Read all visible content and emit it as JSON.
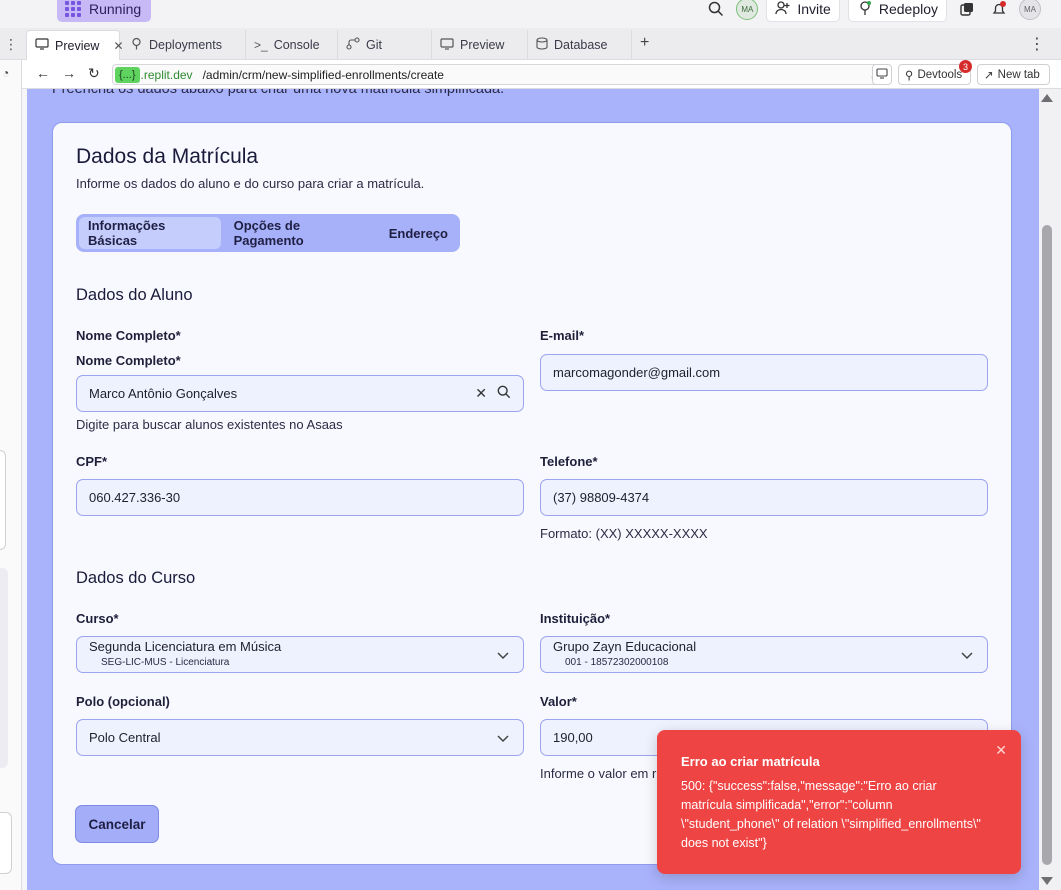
{
  "topbar": {
    "status": "Running",
    "invite": "Invite",
    "redeploy": "Redeploy",
    "avatar1": "MA",
    "avatar2": "MA"
  },
  "tabs": [
    {
      "label": "Preview",
      "icon": "monitor-icon"
    },
    {
      "label": "Deployments",
      "icon": "deploy-icon"
    },
    {
      "label": "Console",
      "icon": "terminal-icon"
    },
    {
      "label": "Git",
      "icon": "git-icon"
    },
    {
      "label": "Preview",
      "icon": "monitor-icon"
    },
    {
      "label": "Database",
      "icon": "database-icon"
    }
  ],
  "urlbar": {
    "host_badge": "{...}",
    "host": ".replit.dev",
    "path": "/admin/crm/new-simplified-enrollments/create",
    "devtools": "Devtools",
    "devtools_count": "3",
    "new_tab": "New tab"
  },
  "page": {
    "cut_text": "Preencha os dados abaixo para criar uma nova matrícula simplificada.",
    "title": "Dados da Matrícula",
    "subtitle": "Informe os dados do aluno e do curso para criar a matrícula.",
    "tabs": [
      "Informações Básicas",
      "Opções de Pagamento",
      "Endereço"
    ],
    "student_section": "Dados do Aluno",
    "name_label": "Nome Completo*",
    "name_label2": "Nome Completo*",
    "name_value": "Marco Antônio Gonçalves",
    "name_help": "Digite para buscar alunos existentes no Asaas",
    "email_label": "E-mail*",
    "email_value": "marcomagonder@gmail.com",
    "cpf_label": "CPF*",
    "cpf_value": "060.427.336-30",
    "phone_label": "Telefone*",
    "phone_value": "(37) 98809-4374",
    "phone_help": "Formato: (XX) XXXXX-XXXX",
    "course_section": "Dados do Curso",
    "course_label": "Curso*",
    "course_value": "Segunda Licenciatura em Música",
    "course_sub": "SEG-LIC-MUS - Licenciatura",
    "inst_label": "Instituição*",
    "inst_value": "Grupo Zayn Educacional",
    "inst_sub": "001 - 18572302000108",
    "polo_label": "Polo (opcional)",
    "polo_value": "Polo Central",
    "valor_label": "Valor*",
    "valor_value": "190,00",
    "valor_help": "Informe o valor em r",
    "cancel": "Cancelar"
  },
  "toast": {
    "title": "Erro ao criar matrícula",
    "body": "500: {\"success\":false,\"message\":\"Erro ao criar matrícula simplificada\",\"error\":\"column \\\"student_phone\\\" of relation \\\"simplified_enrollments\\\" does not exist\"}"
  },
  "colors": {
    "preview_bg": "#a9b3fb",
    "toast_bg": "#ef4444",
    "accent": "#7656e0"
  }
}
